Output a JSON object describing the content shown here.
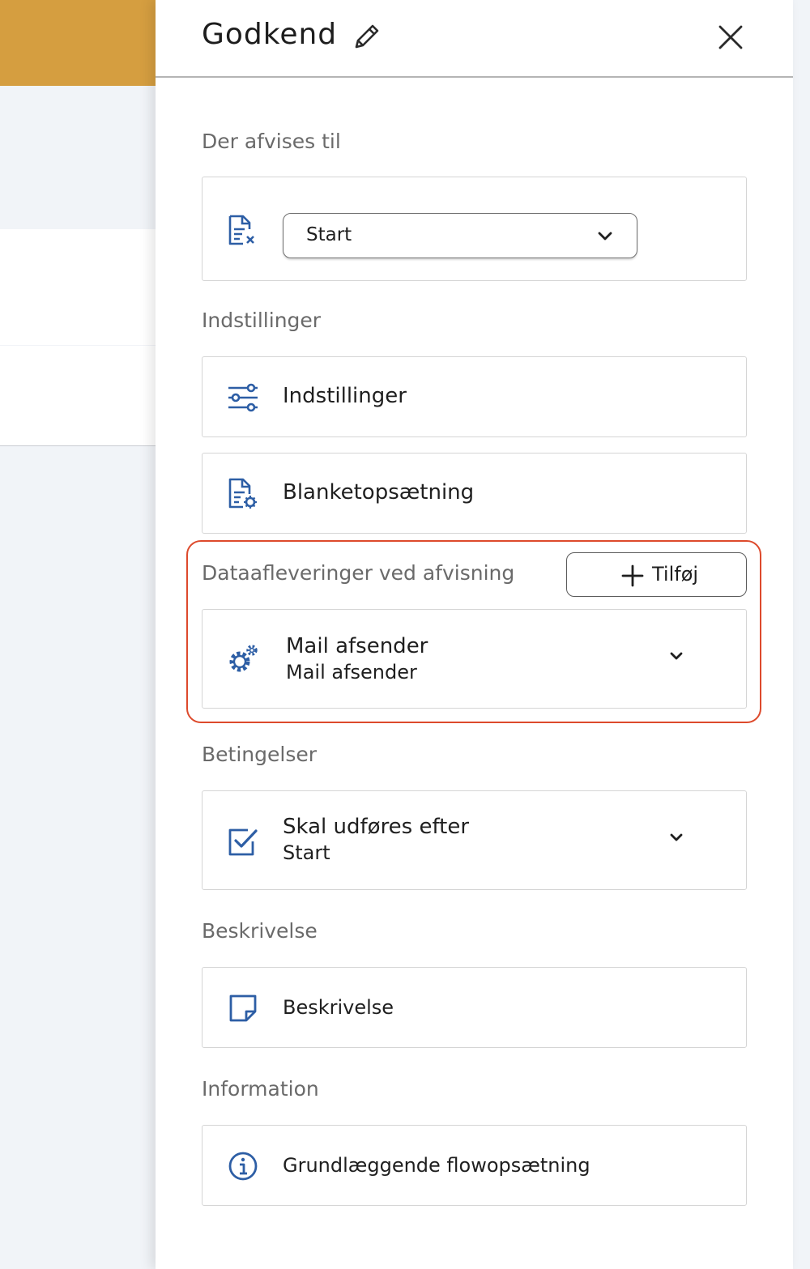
{
  "panel": {
    "title": "Godkend"
  },
  "sections": {
    "rejection_target": {
      "label": "Der afvises til",
      "select_value": "Start"
    },
    "settings": {
      "label": "Indstillinger",
      "settings_item": "Indstillinger",
      "form_setup_item": "Blanketopsætning"
    },
    "data_deliveries": {
      "label": "Dataafleveringer ved afvisning",
      "add_label": "Tilføj",
      "item_title": "Mail afsender",
      "item_subtitle": "Mail afsender"
    },
    "conditions": {
      "label": "Betingelser",
      "item_title": "Skal udføres efter",
      "item_subtitle": "Start"
    },
    "description": {
      "label": "Beskrivelse",
      "item": "Beskrivelse"
    },
    "information": {
      "label": "Information",
      "item": "Grundlæggende flowopsætning"
    }
  },
  "colors": {
    "accent": "#2d5ea5",
    "header_bar": "#d59e40",
    "highlight": "#dd4a2c"
  }
}
